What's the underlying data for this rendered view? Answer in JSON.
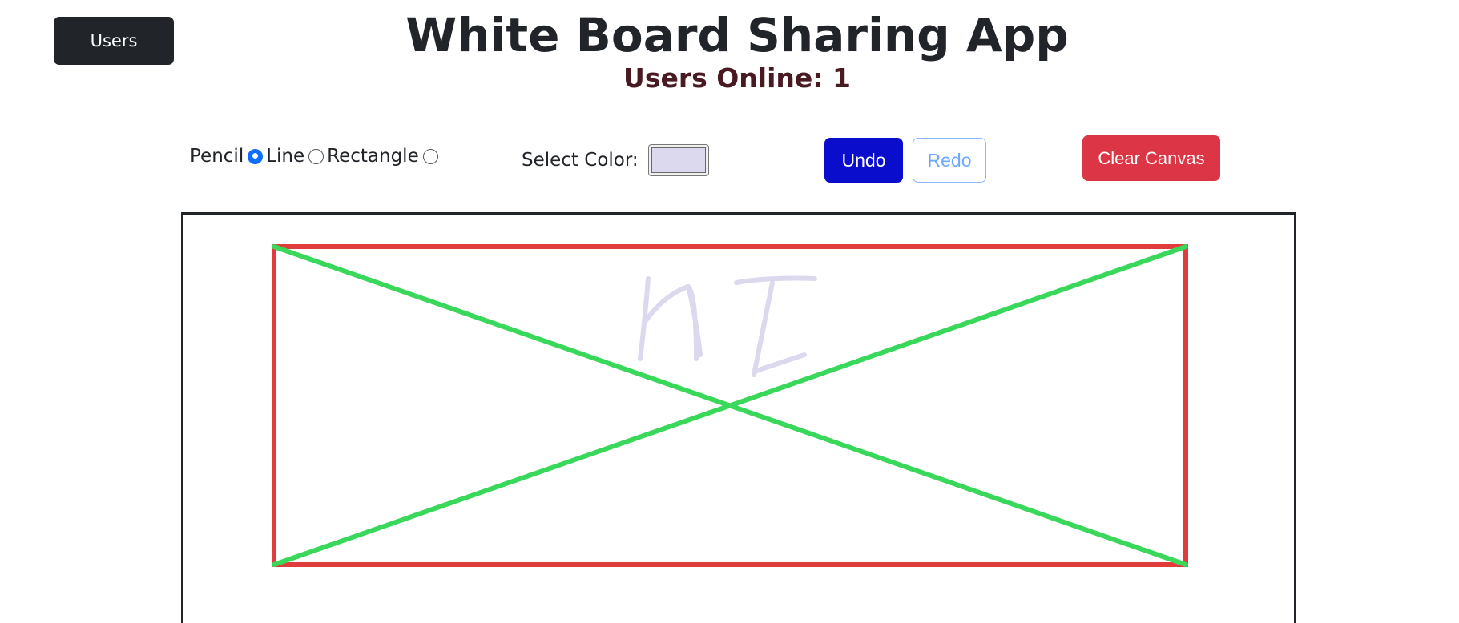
{
  "header": {
    "users_button": "Users",
    "title": "White Board Sharing App",
    "users_online": "Users Online: 1"
  },
  "toolbar": {
    "tools": [
      {
        "label": "Pencil",
        "checked": true
      },
      {
        "label": "Line",
        "checked": false
      },
      {
        "label": "Rectangle",
        "checked": false
      }
    ],
    "color_label": "Select Color:",
    "selected_color": "#dcd8ee",
    "undo_label": "Undo",
    "redo_label": "Redo",
    "clear_label": "Clear Canvas"
  },
  "canvas": {
    "handwritten_text": "HI",
    "stroke_colors": {
      "rectangle": "#e03c3c",
      "lines": "#3ad85a",
      "pencil": "#dcd8ee"
    }
  }
}
